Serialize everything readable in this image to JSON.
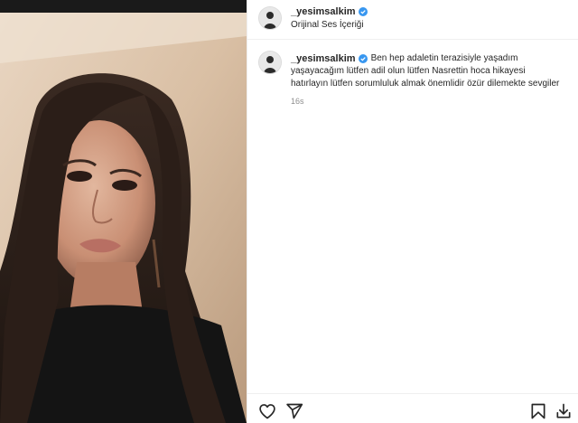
{
  "post": {
    "username": "_yesimsalkim",
    "verified": true,
    "audio_label": "Orijinal Ses İçeriği"
  },
  "caption": {
    "username": "_yesimsalkim",
    "text": "Ben hep adaletin terazisiyle yaşadım yaşayacağım lütfen adil olun lütfen Nasrettin hoca hikayesi hatırlayın lütfen sorumluluk almak önemlidir özür dilemekte sevgiler",
    "time": "16s"
  },
  "colors": {
    "verified_blue": "#3897f0",
    "text": "#262626",
    "muted": "#8e8e8e"
  },
  "icons": {
    "like": "heart-icon",
    "share": "send-icon",
    "save": "bookmark-icon",
    "download": "download-icon"
  }
}
